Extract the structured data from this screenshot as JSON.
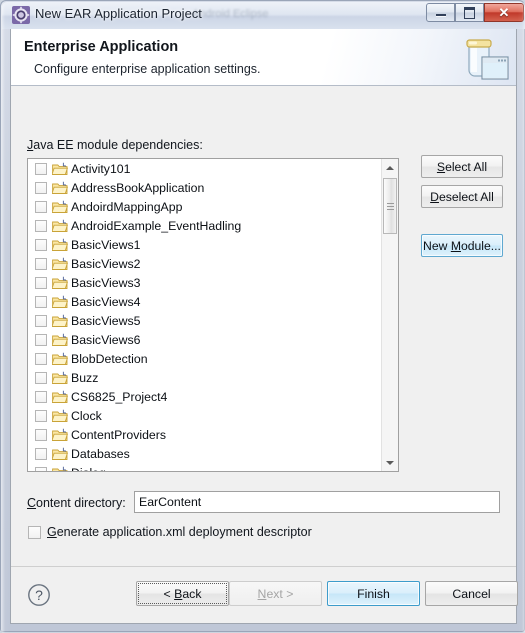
{
  "window": {
    "title": "New EAR Application Project",
    "title_ghost": "Android Eclipse",
    "icon": "eclipse-wizard-icon",
    "controls": [
      {
        "name": "minimize",
        "glyph": "minimize-icon"
      },
      {
        "name": "maximize",
        "glyph": "maximize-icon"
      },
      {
        "name": "close",
        "glyph": "close-icon",
        "label": "✕",
        "color": "#c0392a"
      }
    ]
  },
  "header": {
    "title": "Enterprise Application",
    "description": "Configure enterprise application settings.",
    "icon": "ear-jar-icon"
  },
  "main": {
    "dependencies_label_prefix": "J",
    "dependencies_label_rest": "ava EE module dependencies:",
    "modules": [
      {
        "label": "Activity101",
        "checked": false
      },
      {
        "label": "AddressBookApplication",
        "checked": false
      },
      {
        "label": "AndoirdMappingApp",
        "checked": false
      },
      {
        "label": "AndroidExample_EventHadling",
        "checked": false
      },
      {
        "label": "BasicViews1",
        "checked": false
      },
      {
        "label": "BasicViews2",
        "checked": false
      },
      {
        "label": "BasicViews3",
        "checked": false
      },
      {
        "label": "BasicViews4",
        "checked": false
      },
      {
        "label": "BasicViews5",
        "checked": false
      },
      {
        "label": "BasicViews6",
        "checked": false
      },
      {
        "label": "BlobDetection",
        "checked": false
      },
      {
        "label": "Buzz",
        "checked": false
      },
      {
        "label": "CS6825_Project4",
        "checked": false
      },
      {
        "label": "Clock",
        "checked": false
      },
      {
        "label": "ContentProviders",
        "checked": false
      },
      {
        "label": "Databases",
        "checked": false
      },
      {
        "label": "Dialog",
        "checked": false
      }
    ],
    "scrollbar": {
      "up_arrow": "scroll-up-icon",
      "down_arrow": "scroll-down-icon",
      "thumb_position": "top"
    },
    "buttons": {
      "select_all_mnemonic": "S",
      "select_all_rest": "elect All",
      "deselect_all_mnemonic": "D",
      "deselect_all_rest": "eselect All",
      "new_module_prefix": "New ",
      "new_module_mnemonic": "M",
      "new_module_rest": "odule..."
    },
    "content_directory": {
      "label_mnemonic": "C",
      "label_rest": "ontent directory:",
      "value": "EarContent",
      "placeholder": ""
    },
    "generate_descriptor": {
      "checked": false,
      "label_mnemonic": "G",
      "label_rest": "enerate application.xml deployment descriptor"
    }
  },
  "footer": {
    "help_icon": "help-question-icon",
    "back_prefix": "< ",
    "back_mnemonic": "B",
    "back_rest": "ack",
    "next_mnemonic": "N",
    "next_rest": "ext >",
    "next_enabled": false,
    "finish_label": "Finish",
    "cancel_label": "Cancel",
    "default_button": "Finish"
  }
}
